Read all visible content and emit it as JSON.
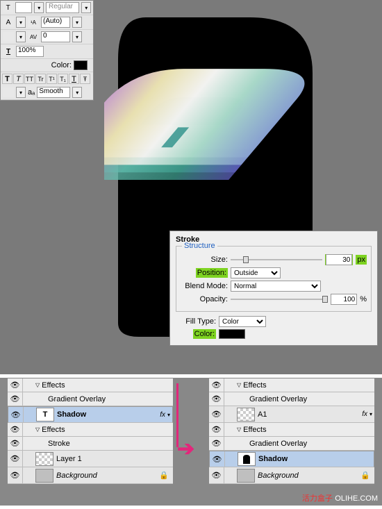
{
  "charPanel": {
    "regular": "Regular",
    "auto": "(Auto)",
    "tracking": "0",
    "scale": "100%",
    "colorLabel": "Color:",
    "aa": "Smooth",
    "aaPrefix": "aₐ"
  },
  "strokePanel": {
    "title": "Stroke",
    "structure": "Structure",
    "sizeLabel": "Size:",
    "sizeValue": "30",
    "sizeUnit": "px",
    "positionLabel": "Position:",
    "positionValue": "Outside",
    "blendLabel": "Blend Mode:",
    "blendValue": "Normal",
    "opacityLabel": "Opacity:",
    "opacityValue": "100",
    "opacityUnit": "%",
    "fillTypeLabel": "Fill Type:",
    "fillTypeValue": "Color",
    "colorLabel": "Color:"
  },
  "layersLeft": {
    "effects": "Effects",
    "gradOverlay": "Gradient Overlay",
    "shadow": "Shadow",
    "stroke": "Stroke",
    "layer1": "Layer 1",
    "background": "Background"
  },
  "layersRight": {
    "effects": "Effects",
    "gradOverlay": "Gradient Overlay",
    "a1": "A1",
    "shadow": "Shadow",
    "background": "Background"
  },
  "watermark": {
    "red": "活力盒子",
    "rest": "OLIHE.COM"
  }
}
